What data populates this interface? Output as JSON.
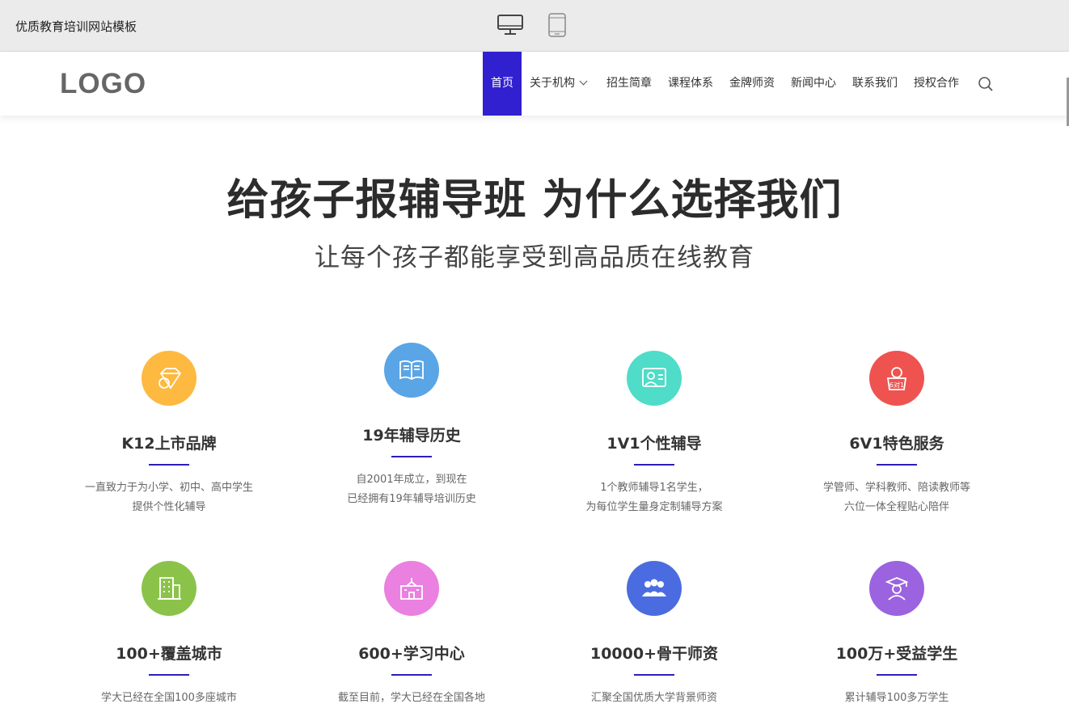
{
  "preview": {
    "title": "优质教育培训网站模板",
    "devices": [
      "desktop-icon",
      "tablet-icon"
    ]
  },
  "header": {
    "logo": "LOGO",
    "nav": [
      {
        "label": "首页",
        "active": true
      },
      {
        "label": "关于机构",
        "dropdown": true
      },
      {
        "label": "招生简章"
      },
      {
        "label": "课程体系"
      },
      {
        "label": "金牌师资"
      },
      {
        "label": "新闻中心"
      },
      {
        "label": "联系我们"
      },
      {
        "label": "授权合作"
      }
    ],
    "accent": "#3120d0"
  },
  "hero": {
    "title": "给孩子报辅导班 为什么选择我们",
    "subtitle": "让每个孩子都能享受到高品质在线教育"
  },
  "features": [
    {
      "title": "K12上市品牌",
      "desc": [
        "一直致力于为小学、初中、高中学生",
        "提供个性化辅导"
      ],
      "color": "#fdb940",
      "icon": "diamond-icon"
    },
    {
      "title": "19年辅导历史",
      "desc": [
        "自2001年成立，到现在",
        "已经拥有19年辅导培训历史"
      ],
      "color": "#5aa5e6",
      "icon": "book-icon"
    },
    {
      "title": "1V1个性辅导",
      "desc": [
        "1个教师辅导1名学生，",
        "为每位学生量身定制辅导方案"
      ],
      "color": "#4fdcc8",
      "icon": "teacher-icon"
    },
    {
      "title": "6V1特色服务",
      "desc": [
        "学管师、学科教师、陪读教师等",
        "六位一体全程贴心陪伴"
      ],
      "color": "#ef5350",
      "icon": "service-icon"
    },
    {
      "title": "100+覆盖城市",
      "desc": [
        "学大已经在全国100多座城市"
      ],
      "color": "#8bc34a",
      "icon": "building-icon"
    },
    {
      "title": "600+学习中心",
      "desc": [
        "截至目前，学大已经在全国各地"
      ],
      "color": "#ea80e0",
      "icon": "school-icon"
    },
    {
      "title": "10000+骨干师资",
      "desc": [
        "汇聚全国优质大学背景师资"
      ],
      "color": "#4b6ce0",
      "icon": "group-icon"
    },
    {
      "title": "100万+受益学生",
      "desc": [
        "累计辅导100多万学生"
      ],
      "color": "#9b63e0",
      "icon": "graduate-icon"
    }
  ]
}
